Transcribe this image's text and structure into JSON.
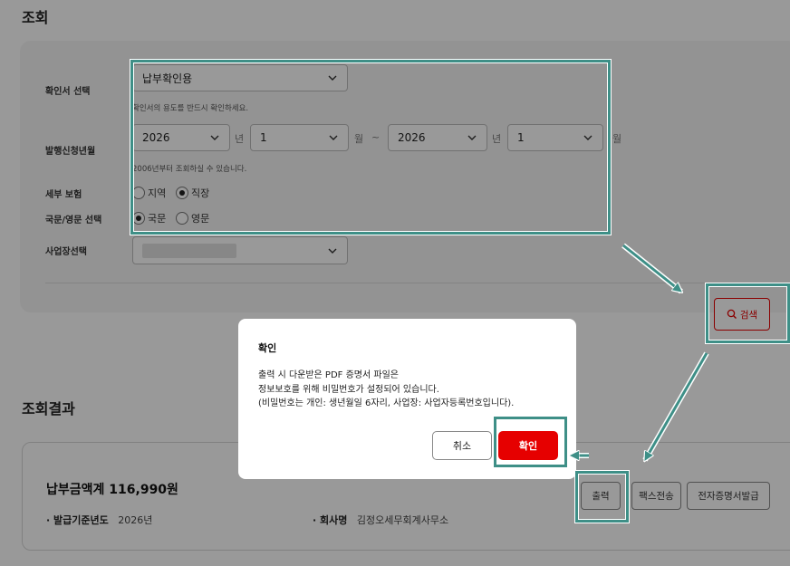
{
  "section_search_title": "조회",
  "form": {
    "cert_label": "확인서 선택",
    "cert_value": "납부확인용",
    "cert_hint": "확인서의 용도를 반드시 확인하세요.",
    "period_label": "발행신청년월",
    "from_year": "2026",
    "from_month": "1",
    "to_year": "2026",
    "to_month": "1",
    "unit_year": "년",
    "unit_month": "월",
    "tilde": "~",
    "period_hint": "2006년부터 조회하실 수 있습니다.",
    "insurance_label": "세부 보험",
    "insurance_opt1": "지역",
    "insurance_opt2": "직장",
    "insurance_selected": "직장",
    "language_label": "국문/영문 선택",
    "language_opt1": "국문",
    "language_opt2": "영문",
    "language_selected": "국문",
    "workplace_label": "사업장선택",
    "search_button": "검색"
  },
  "results": {
    "title": "조회결과",
    "total_label": "납부금액계",
    "total_value": "116,990원",
    "year_label": "발급기준년도",
    "year_value": "2026년",
    "company_label": "회사명",
    "company_value": "김정오세무회계사무소",
    "print_button": "출력",
    "fax_button": "팩스전송",
    "ecert_button": "전자증명서발급"
  },
  "modal": {
    "title": "확인",
    "line1": "출력 시 다운받은 PDF 증명서 파일은",
    "line2": "정보보호를 위해 비밀번호가 설정되어 있습니다.",
    "line3": "(비밀번호는 개인: 생년월일 6자리, 사업장: 사업자등록번호입니다).",
    "cancel_button": "취소",
    "confirm_button": "확인"
  },
  "colors": {
    "accent_red": "#e60000",
    "annotation_teal": "#3e8f87"
  }
}
